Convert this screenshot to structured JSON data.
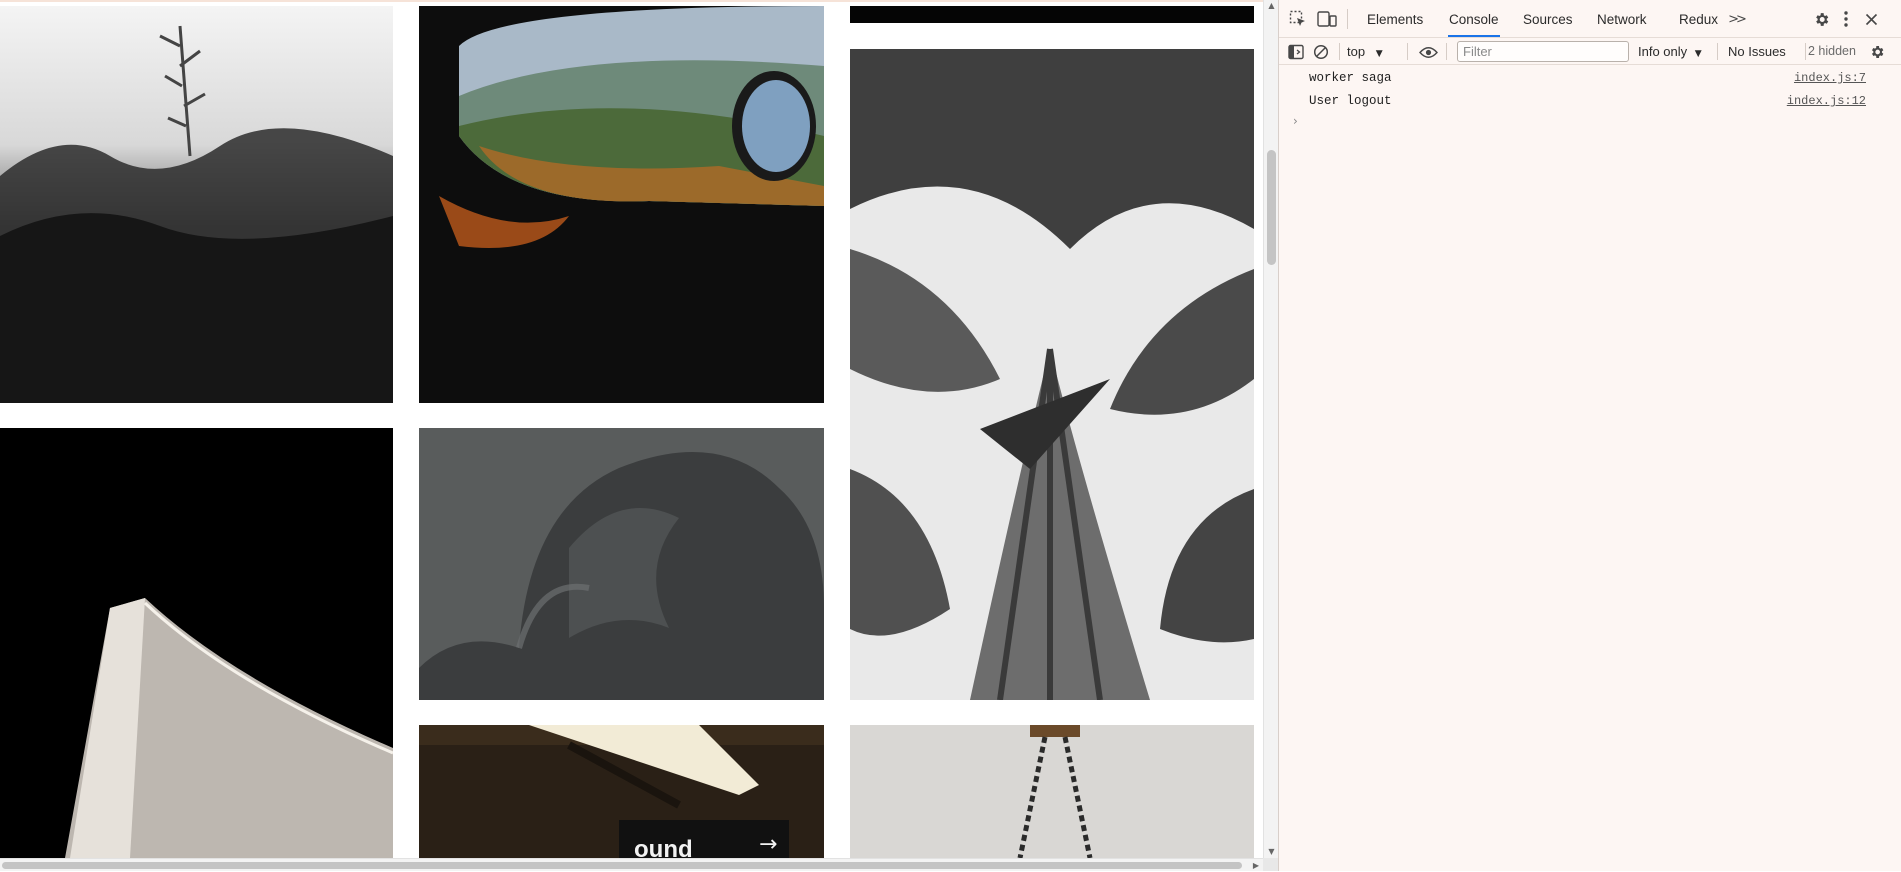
{
  "devtools": {
    "tabs": [
      {
        "label": "Elements",
        "active": false
      },
      {
        "label": "Console",
        "active": true
      },
      {
        "label": "Sources",
        "active": false
      },
      {
        "label": "Network",
        "active": false
      },
      {
        "label": "Redux",
        "active": false
      }
    ],
    "more_tabs_glyph": ">>",
    "toolbar": {
      "context": "top",
      "filter_placeholder": "Filter",
      "filter_value": "",
      "level": "Info only",
      "issues": "No Issues",
      "hidden": "2 hidden"
    },
    "logs": [
      {
        "message": "worker saga",
        "source": "index.js:7"
      },
      {
        "message": "User logout",
        "source": "index.js:12"
      }
    ],
    "prompt_glyph": "›"
  },
  "page": {
    "images": [
      {
        "name": "grass-photo",
        "subject": "black and white fern and grass"
      },
      {
        "name": "car-window-photo",
        "subject": "mountains seen through car window"
      },
      {
        "name": "black-strip-photo",
        "subject": "black image edge"
      },
      {
        "name": "palm-leaves-photo",
        "subject": "black and white bird of paradise plant"
      },
      {
        "name": "mesh-sculpture-photo",
        "subject": "white mesh sculpture on black"
      },
      {
        "name": "gray-blob-photo",
        "subject": "gray 3d blob render"
      },
      {
        "name": "subway-sign-photo",
        "subject": "subway ceiling lights and sign"
      },
      {
        "name": "chain-lamp-photo",
        "subject": "hanging chains on white wall"
      }
    ],
    "subway_sign_text": "ound",
    "subway_sign_arrow": "→"
  }
}
